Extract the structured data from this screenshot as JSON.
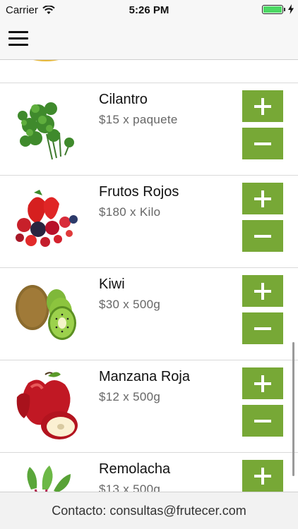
{
  "status_bar": {
    "carrier": "Carrier",
    "time": "5:26 PM",
    "battery_level": 1.0,
    "battery_color": "#4cd964"
  },
  "nav": {
    "menu_icon": "hamburger-menu-icon"
  },
  "products": [
    {
      "name": "Cilantro",
      "price": "$15 x paquete",
      "image_icon": "cilantro-image"
    },
    {
      "name": "Frutos Rojos",
      "price": "$180 x Kilo",
      "image_icon": "red-berries-image"
    },
    {
      "name": "Kiwi",
      "price": "$30 x 500g",
      "image_icon": "kiwi-image"
    },
    {
      "name": "Manzana Roja",
      "price": "$12 x 500g",
      "image_icon": "red-apple-image"
    },
    {
      "name": "Remolacha",
      "price": "$13 x 500g",
      "image_icon": "beet-image"
    }
  ],
  "buttons": {
    "plus_icon": "plus-icon",
    "minus_icon": "minus-icon",
    "color": "#77a836"
  },
  "footer": {
    "text": "Contacto: consultas@frutecer.com"
  }
}
